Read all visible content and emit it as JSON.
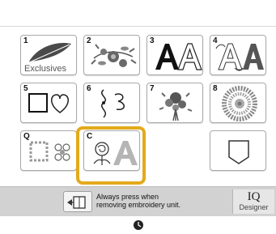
{
  "categories": [
    {
      "number": "1",
      "caption": "Exclusives",
      "icon": "feather-icon"
    },
    {
      "number": "2",
      "caption": "",
      "icon": "floral-spray-icon"
    },
    {
      "number": "3",
      "caption": "",
      "icon": "alphabet-outline-icon"
    },
    {
      "number": "4",
      "caption": "",
      "icon": "alphabet-fancy-icon"
    },
    {
      "number": "5",
      "caption": "",
      "icon": "frame-outline-icon"
    },
    {
      "number": "6",
      "caption": "",
      "icon": "flourish-icon"
    },
    {
      "number": "7",
      "caption": "",
      "icon": "bouquet-icon"
    },
    {
      "number": "8",
      "caption": "",
      "icon": "round-motif-icon"
    },
    {
      "number": "Q",
      "caption": "",
      "icon": "quilt-border-icon"
    },
    {
      "number": "C",
      "caption": "",
      "icon": "rose-letter-icon",
      "selected": true
    },
    {
      "number": "",
      "caption": "",
      "icon": "pocket-icon"
    }
  ],
  "bottom_bar": {
    "hint_line1": "Always press when",
    "hint_line2": "removing embroidery unit.",
    "iq_label": "IQ",
    "iq_sub": "Designer"
  },
  "colors": {
    "selection": "#e3aa1c",
    "bar": "#d2d2d2"
  }
}
